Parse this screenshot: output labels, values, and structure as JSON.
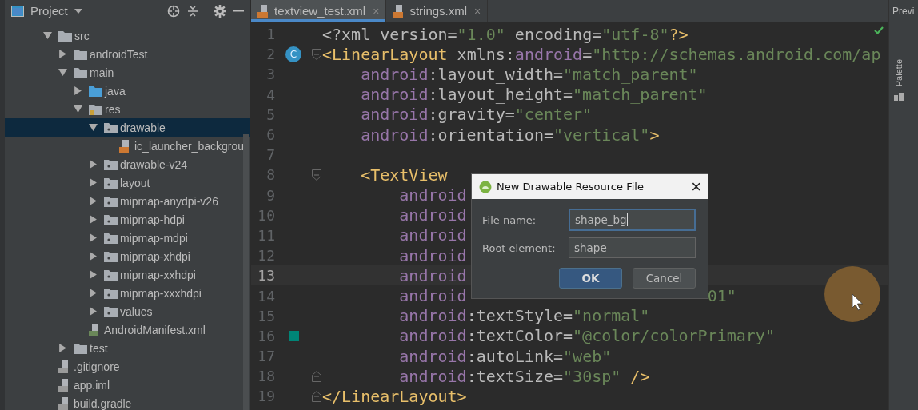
{
  "project_panel": {
    "title": "Project",
    "tree": [
      {
        "name": "src",
        "kind": "folder",
        "expanded": true,
        "selected": false,
        "children": [
          {
            "name": "androidTest",
            "kind": "folder",
            "expanded": false,
            "selected": false
          },
          {
            "name": "main",
            "kind": "folder",
            "expanded": true,
            "selected": false,
            "children": [
              {
                "name": "java",
                "kind": "java-folder",
                "expanded": false,
                "selected": false
              },
              {
                "name": "res",
                "kind": "res-folder",
                "expanded": true,
                "selected": false,
                "children": [
                  {
                    "name": "drawable",
                    "kind": "res-dir",
                    "expanded": true,
                    "selected": true,
                    "children": [
                      {
                        "name": "ic_launcher_backgrou",
                        "kind": "xml-file",
                        "selected": false
                      }
                    ]
                  },
                  {
                    "name": "drawable-v24",
                    "kind": "res-dir",
                    "expanded": false,
                    "selected": false
                  },
                  {
                    "name": "layout",
                    "kind": "res-dir",
                    "expanded": false,
                    "selected": false
                  },
                  {
                    "name": "mipmap-anydpi-v26",
                    "kind": "res-dir",
                    "expanded": false,
                    "selected": false
                  },
                  {
                    "name": "mipmap-hdpi",
                    "kind": "res-dir",
                    "expanded": false,
                    "selected": false
                  },
                  {
                    "name": "mipmap-mdpi",
                    "kind": "res-dir",
                    "expanded": false,
                    "selected": false
                  },
                  {
                    "name": "mipmap-xhdpi",
                    "kind": "res-dir",
                    "expanded": false,
                    "selected": false
                  },
                  {
                    "name": "mipmap-xxhdpi",
                    "kind": "res-dir",
                    "expanded": false,
                    "selected": false
                  },
                  {
                    "name": "mipmap-xxxhdpi",
                    "kind": "res-dir",
                    "expanded": false,
                    "selected": false
                  },
                  {
                    "name": "values",
                    "kind": "res-dir",
                    "expanded": false,
                    "selected": false
                  }
                ]
              },
              {
                "name": "AndroidManifest.xml",
                "kind": "manifest-file",
                "selected": false
              }
            ]
          },
          {
            "name": "test",
            "kind": "folder",
            "expanded": false,
            "selected": false
          }
        ]
      },
      {
        "name": ".gitignore",
        "kind": "text-file",
        "selected": false
      },
      {
        "name": "app.iml",
        "kind": "module-file",
        "selected": false
      },
      {
        "name": "build.gradle",
        "kind": "gradle-file",
        "selected": false
      }
    ]
  },
  "tabs": [
    {
      "label": "textview_test.xml",
      "selected": true,
      "close": "×"
    },
    {
      "label": "strings.xml",
      "selected": false,
      "close": "×"
    }
  ],
  "editor": {
    "lines": [
      {
        "number": "1",
        "current": false,
        "segments": [
          {
            "kind": "plain",
            "text": "<?xml version="
          },
          {
            "kind": "value",
            "text": "\"1.0\""
          },
          {
            "kind": "plain",
            "text": " encoding="
          },
          {
            "kind": "value",
            "text": "\"utf-8\""
          },
          {
            "kind": "tag",
            "text": "?>"
          }
        ]
      },
      {
        "number": "2",
        "current": false,
        "badge": "C",
        "fold_start": true,
        "segments": [
          {
            "kind": "tag",
            "text": "<LinearLayout"
          },
          {
            "kind": "plain",
            "text": " xmlns:"
          },
          {
            "kind": "ns",
            "text": "android"
          },
          {
            "kind": "plain",
            "text": "="
          },
          {
            "kind": "value",
            "text": "\"http://schemas.android.com/ap"
          }
        ]
      },
      {
        "number": "3",
        "current": false,
        "segments": [
          {
            "kind": "ns",
            "text": "    android"
          },
          {
            "kind": "plain",
            "text": ":layout_width="
          },
          {
            "kind": "value",
            "text": "\"match_parent\""
          }
        ]
      },
      {
        "number": "4",
        "current": false,
        "segments": [
          {
            "kind": "ns",
            "text": "    android"
          },
          {
            "kind": "plain",
            "text": ":layout_height="
          },
          {
            "kind": "value",
            "text": "\"match_parent\""
          }
        ]
      },
      {
        "number": "5",
        "current": false,
        "segments": [
          {
            "kind": "ns",
            "text": "    android"
          },
          {
            "kind": "plain",
            "text": ":gravity="
          },
          {
            "kind": "value",
            "text": "\"center\""
          }
        ]
      },
      {
        "number": "6",
        "current": false,
        "segments": [
          {
            "kind": "ns",
            "text": "    android"
          },
          {
            "kind": "plain",
            "text": ":orientation="
          },
          {
            "kind": "value",
            "text": "\"vertical\""
          },
          {
            "kind": "tag",
            "text": ">"
          }
        ]
      },
      {
        "number": "7",
        "current": false
      },
      {
        "number": "8",
        "current": false,
        "fold_start": true,
        "segments": [
          {
            "kind": "tag",
            "text": "    <TextView"
          }
        ]
      },
      {
        "number": "9",
        "current": false,
        "segments": [
          {
            "kind": "ns",
            "text": "        android"
          }
        ]
      },
      {
        "number": "10",
        "current": false,
        "segments": [
          {
            "kind": "ns",
            "text": "        android"
          }
        ]
      },
      {
        "number": "11",
        "current": false,
        "segments": [
          {
            "kind": "ns",
            "text": "        android"
          }
        ]
      },
      {
        "number": "12",
        "current": false,
        "segments": [
          {
            "kind": "ns",
            "text": "        android"
          }
        ]
      },
      {
        "number": "13",
        "current": true,
        "segments": [
          {
            "kind": "ns",
            "text": "        android"
          }
        ]
      },
      {
        "number": "14",
        "current": false,
        "segments": [
          {
            "kind": "ns",
            "text": "        android"
          },
          {
            "kind": "tail",
            "text": "01\""
          }
        ]
      },
      {
        "number": "15",
        "current": false,
        "segments": [
          {
            "kind": "ns",
            "text": "        android"
          },
          {
            "kind": "plain",
            "text": ":textStyle="
          },
          {
            "kind": "value",
            "text": "\"normal\""
          }
        ]
      },
      {
        "number": "16",
        "current": false,
        "color": "#008577",
        "segments": [
          {
            "kind": "ns",
            "text": "        android"
          },
          {
            "kind": "plain",
            "text": ":textColor="
          },
          {
            "kind": "value",
            "text": "\"@color/colorPrimary\""
          }
        ]
      },
      {
        "number": "17",
        "current": false,
        "segments": [
          {
            "kind": "ns",
            "text": "        android"
          },
          {
            "kind": "plain",
            "text": ":autoLink="
          },
          {
            "kind": "value",
            "text": "\"web\""
          }
        ]
      },
      {
        "number": "18",
        "current": false,
        "fold_end": true,
        "segments": [
          {
            "kind": "ns",
            "text": "        android"
          },
          {
            "kind": "plain",
            "text": ":textSize="
          },
          {
            "kind": "value",
            "text": "\"30sp\""
          },
          {
            "kind": "tag",
            "text": " />"
          }
        ]
      },
      {
        "number": "19",
        "current": false,
        "fold_end": true,
        "segments": [
          {
            "kind": "tag",
            "text": "</LinearLayout>"
          }
        ]
      }
    ]
  },
  "dialog": {
    "title": "New Drawable Resource File",
    "close": "×",
    "fields": [
      {
        "label": "File name:",
        "value": "shape_bg",
        "focused": true
      },
      {
        "label": "Root element:",
        "value": "shape",
        "focused": false
      }
    ],
    "buttons": [
      {
        "label": "OK",
        "default": true
      },
      {
        "label": "Cancel",
        "default": false
      }
    ]
  },
  "right_panel": {
    "tool_window": "Palette",
    "preview_title": "Previ"
  }
}
